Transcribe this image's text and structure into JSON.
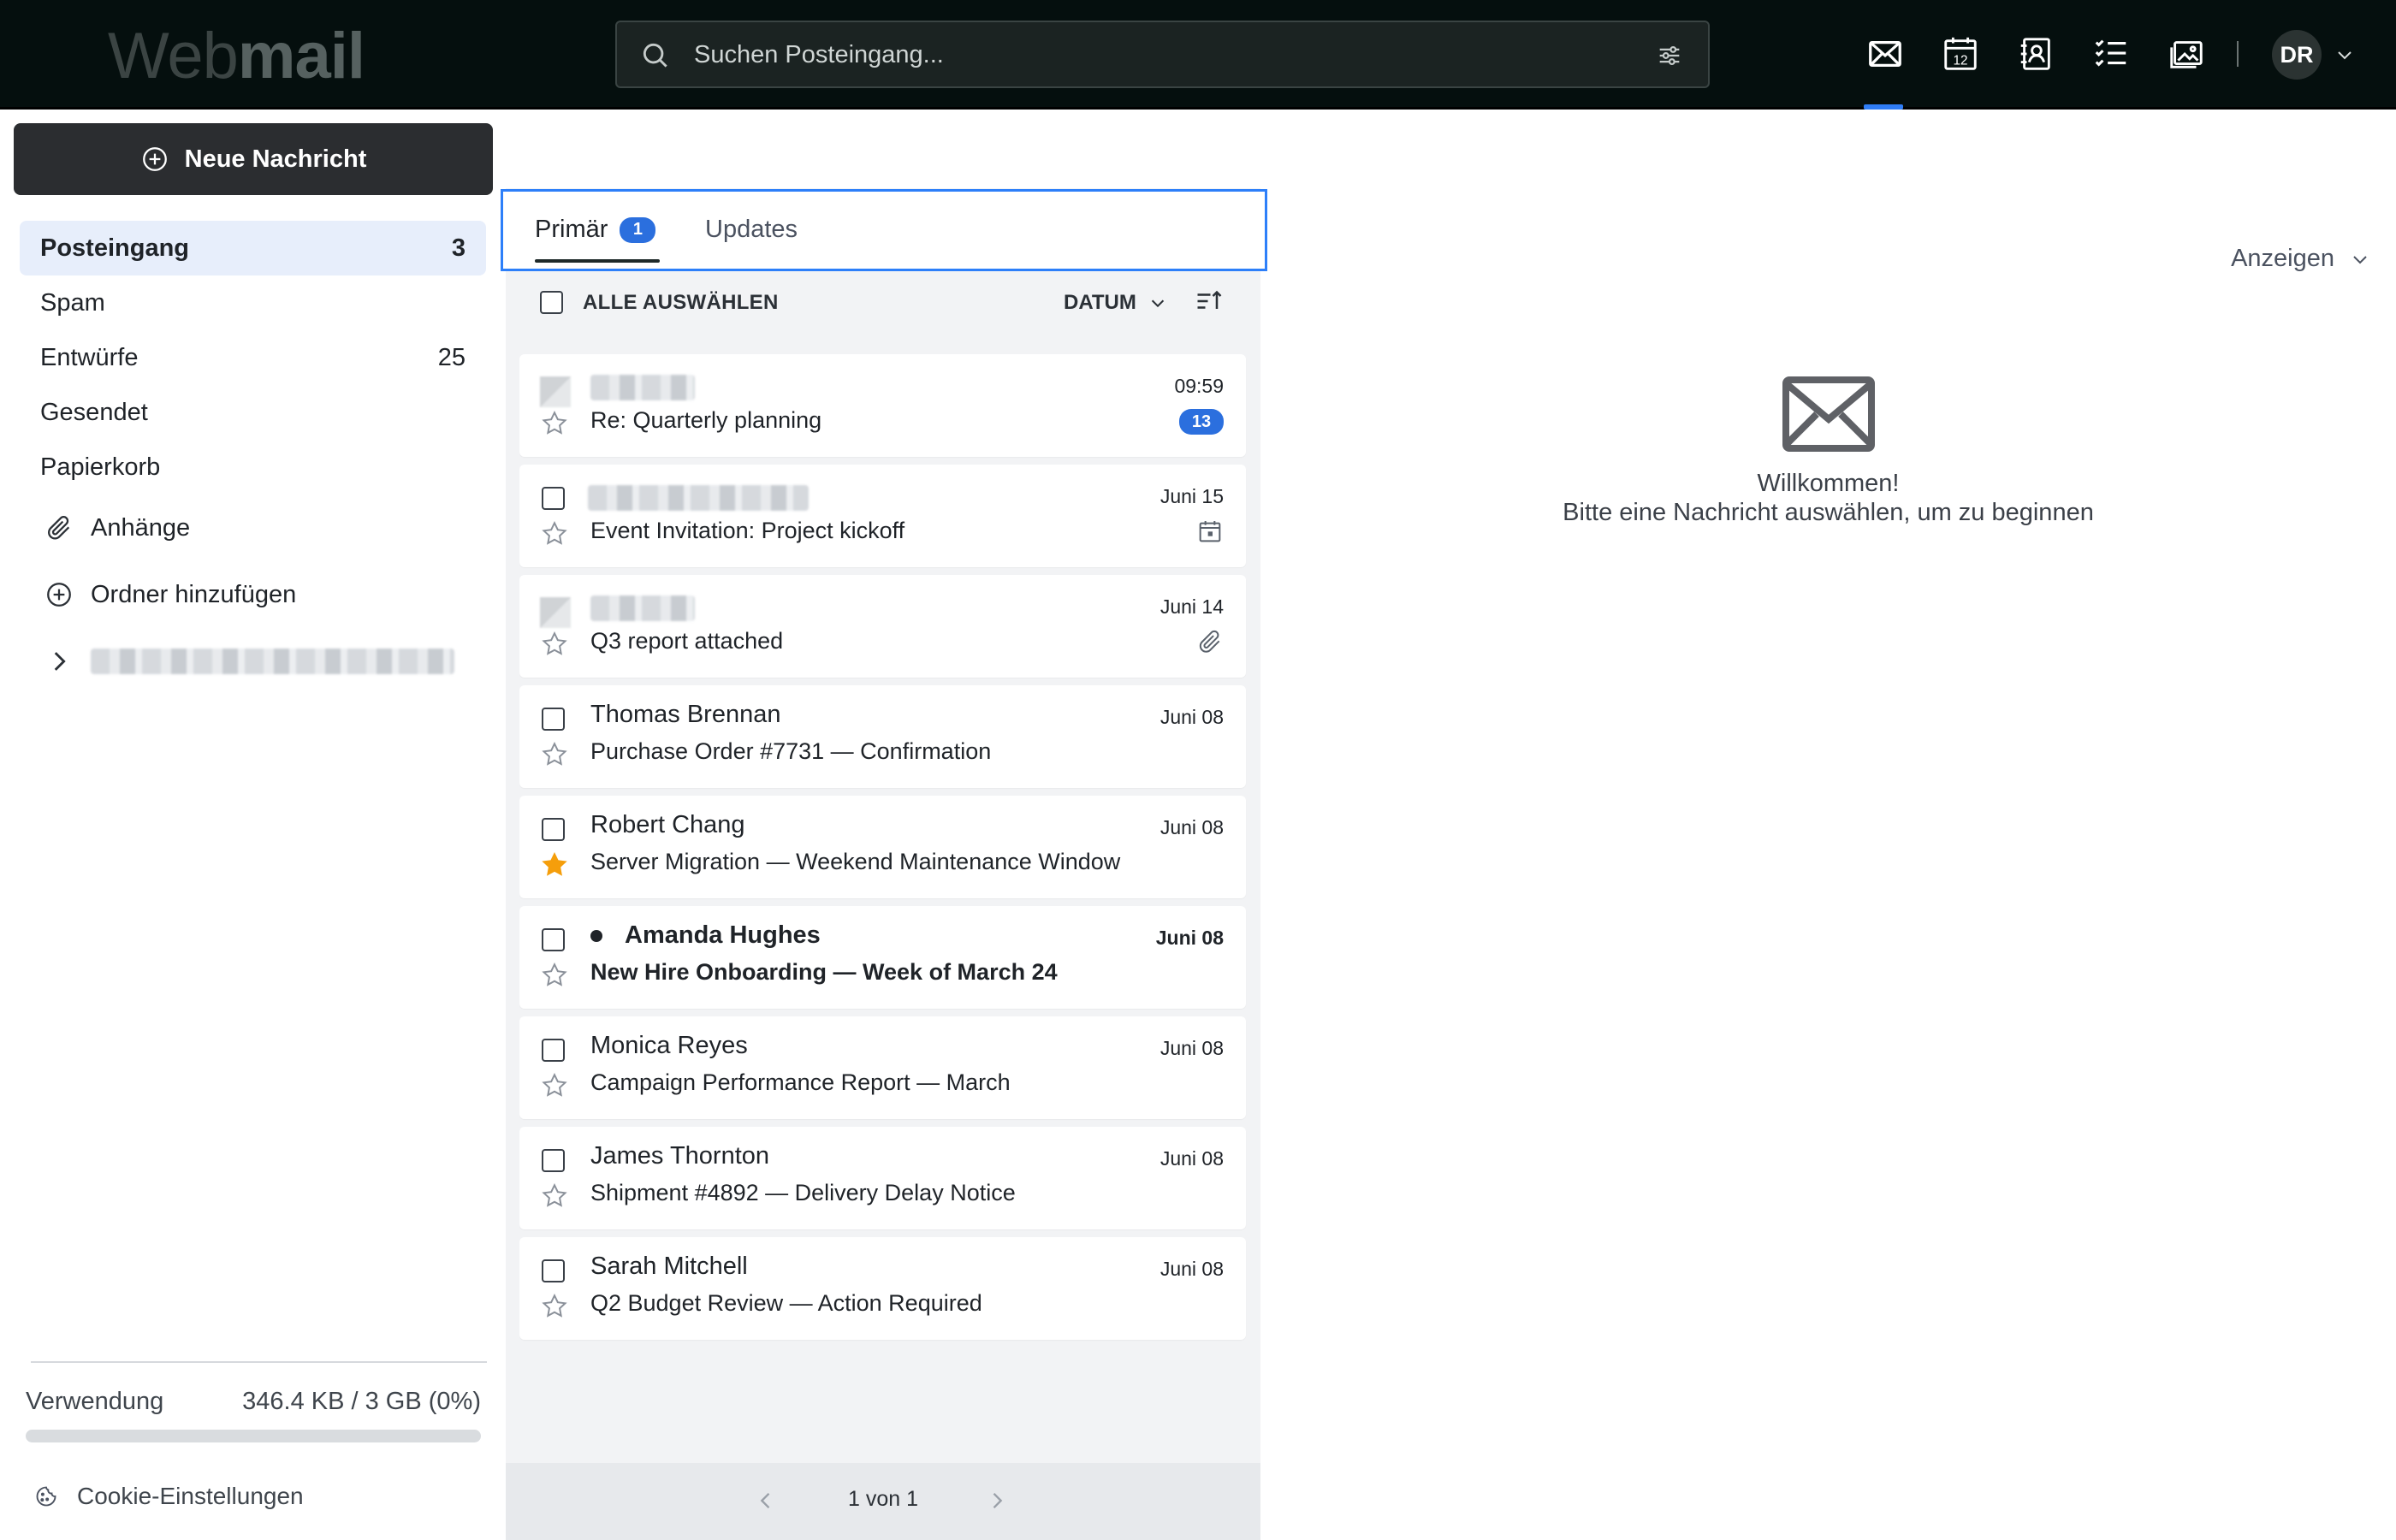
{
  "app": {
    "logo_light": "Web",
    "logo_bold": "mail"
  },
  "search": {
    "placeholder": "Suchen Posteingang..."
  },
  "topnav": {
    "icons": [
      "mail-icon",
      "calendar-icon",
      "contacts-icon",
      "tasks-icon",
      "photos-icon"
    ],
    "active": "mail",
    "calendar_day": "12"
  },
  "user": {
    "initials": "DR"
  },
  "compose": {
    "label": "Neue Nachricht"
  },
  "folders": [
    {
      "label": "Posteingang",
      "count": "3",
      "active": true
    },
    {
      "label": "Spam",
      "count": ""
    },
    {
      "label": "Entwürfe",
      "count": "25"
    },
    {
      "label": "Gesendet",
      "count": ""
    },
    {
      "label": "Papierkorb",
      "count": ""
    }
  ],
  "sidebar": {
    "attachments": "Anhänge",
    "add_folder": "Ordner hinzufügen"
  },
  "usage": {
    "label": "Verwendung",
    "value": "346.4 KB / 3 GB (0%)",
    "fraction": 0.0
  },
  "cookie": {
    "label": "Cookie-Einstellungen"
  },
  "tabs": [
    {
      "label": "Primär",
      "badge": "1",
      "active": true
    },
    {
      "label": "Updates"
    }
  ],
  "toolbar": {
    "select_all": "ALLE AUSWÄHLEN",
    "sort": "DATUM"
  },
  "messages": [
    {
      "from": "",
      "subject": "Re: Quarterly planning",
      "date": "09:59",
      "badge": "13",
      "starred": false,
      "unread": false,
      "sender_hidden": true
    },
    {
      "from": "",
      "subject": "Event Invitation: Project kickoff",
      "date": "Juni 15",
      "icon": "calendar-icon",
      "starred": false,
      "unread": false,
      "sender_hidden": true
    },
    {
      "from": "",
      "subject": "Q3 report attached",
      "date": "Juni 14",
      "icon": "paperclip-icon",
      "starred": false,
      "unread": false,
      "sender_hidden": true
    },
    {
      "from": "Thomas Brennan",
      "subject": "Purchase Order #7731 — Confirmation",
      "date": "Juni 08",
      "starred": false,
      "unread": false
    },
    {
      "from": "Robert Chang",
      "subject": "Server Migration — Weekend Maintenance Window",
      "date": "Juni 08",
      "starred": true,
      "unread": false
    },
    {
      "from": "Amanda Hughes",
      "subject": "New Hire Onboarding — Week of March 24",
      "date": "Juni 08",
      "starred": false,
      "unread": true
    },
    {
      "from": "Monica Reyes",
      "subject": "Campaign Performance Report — March",
      "date": "Juni 08",
      "starred": false,
      "unread": false
    },
    {
      "from": "James Thornton",
      "subject": "Shipment #4892 — Delivery Delay Notice",
      "date": "Juni 08",
      "starred": false,
      "unread": false
    },
    {
      "from": "Sarah Mitchell",
      "subject": "Q2 Budget Review — Action Required",
      "date": "Juni 08",
      "starred": false,
      "unread": false
    }
  ],
  "pager": {
    "text": "1 von 1"
  },
  "reading": {
    "view_label": "Anzeigen",
    "welcome_title": "Willkommen!",
    "welcome_text": "Bitte eine Nachricht auswählen, um zu beginnen"
  },
  "colors": {
    "topbar": "#050f0e",
    "accent": "#2b6fde",
    "star": "#f59e0b"
  }
}
